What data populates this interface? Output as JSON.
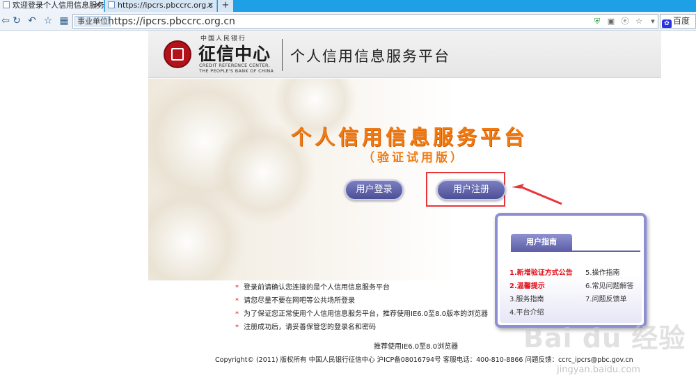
{
  "browser": {
    "tabs": [
      {
        "label": "欢迎登录个人信用信息服务",
        "active": true
      },
      {
        "label": "https://ipcrs.pbccrc.org.c",
        "active": false
      }
    ],
    "site_badge": "事业单位",
    "url": "https://ipcrs.pbccrc.org.cn",
    "search_engine": "百度",
    "icons": [
      "back-icon",
      "refresh-icon",
      "undo-icon",
      "star-icon",
      "apps-icon",
      "shield-icon",
      "qr-icon",
      "compat-icon",
      "favorite-icon",
      "dropdown-icon"
    ]
  },
  "header": {
    "logo_top": "中国人民银行",
    "logo_name": "征信中心",
    "logo_en_line1": "CREDIT REFERENCE CENTER,",
    "logo_en_line2": "THE PEOPLE'S BANK OF CHINA",
    "platform_title": "个人信用信息服务平台"
  },
  "hero": {
    "title": "个人信用信息服务平台",
    "subtitle": "（验证试用版）",
    "login_label": "用户登录",
    "register_label": "用户注册"
  },
  "guide": {
    "title": "用户指南",
    "left_items": [
      {
        "label": "1.新增验证方式公告",
        "highlight": true
      },
      {
        "label": "2.温馨提示",
        "highlight": true
      },
      {
        "label": "3.服务指南",
        "highlight": false
      },
      {
        "label": "4.平台介绍",
        "highlight": false
      }
    ],
    "right_items": [
      {
        "label": "5.操作指南"
      },
      {
        "label": "6.常见问题解答"
      },
      {
        "label": "7.问题反馈单"
      }
    ]
  },
  "notes": [
    "登录前请确认您连接的是个人信用信息服务平台",
    "请您尽量不要在网吧等公共场所登录",
    "为了保证您正常使用个人信用信息服务平台，推荐使用IE6.0至8.0版本的浏览器",
    "注册成功后，请妥善保管您的登录名和密码"
  ],
  "footer": {
    "recommend": "推荐使用IE6.0至8.0浏览器",
    "copyright": "Copyright© (2011) 版权所有 中国人民银行征信中心 沪ICP备08016794号 客服电话：400-810-8866 问题反馈：ccrc_ipcrs@pbc.gov.cn"
  },
  "watermark": {
    "brand": "Bai du 经验",
    "url": "jingyan.baidu.com"
  },
  "colors": {
    "accent_orange": "#f07a12",
    "button_purple": "#5f61a9",
    "highlight_red": "#e8353a",
    "tabbar_blue": "#1ea0e6"
  }
}
